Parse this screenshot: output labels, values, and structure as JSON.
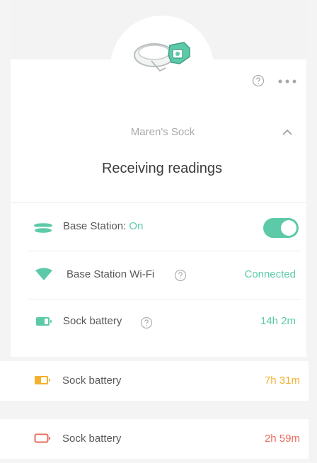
{
  "header": {
    "sock_name": "Maren's Sock",
    "status": "Receiving readings"
  },
  "rows": {
    "base_station": {
      "label": "Base Station: ",
      "state": "On",
      "toggle_on": true
    },
    "wifi": {
      "label": "Base Station Wi-Fi",
      "value": "Connected"
    },
    "battery_main": {
      "label": "Sock battery",
      "value": "14h 2m"
    }
  },
  "battery_examples": [
    {
      "label": "Sock battery",
      "value": "7h 31m",
      "color": "#f3b12e"
    },
    {
      "label": "Sock battery",
      "value": "2h 59m",
      "color": "#ea6d5f"
    }
  ],
  "colors": {
    "accent": "#5ccaa9",
    "warning": "#f3b12e",
    "danger": "#ea6d5f"
  },
  "icons": [
    "help-icon",
    "more-icon",
    "chevron-up-icon",
    "base-station-icon",
    "wifi-icon",
    "battery-icon"
  ]
}
